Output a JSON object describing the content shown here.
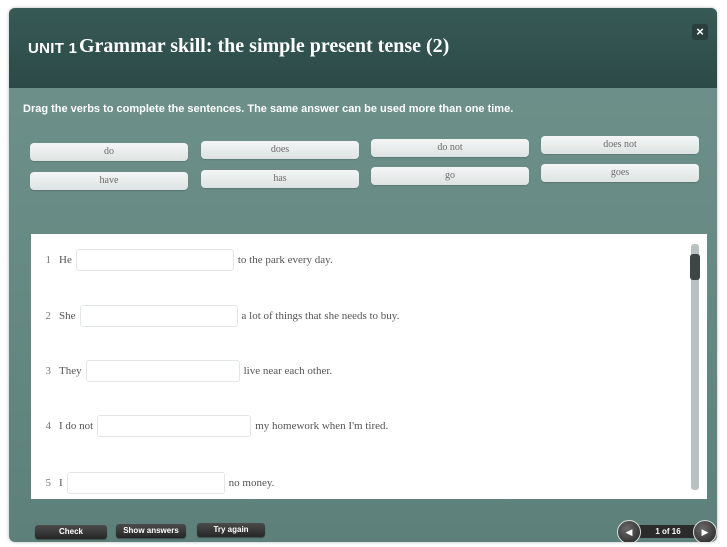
{
  "header": {
    "unit": "UNIT 1",
    "title": "Grammar skill: the simple present tense (2)",
    "close_symbol": "×"
  },
  "instruction": "Drag the verbs to complete the sentences. The same answer can be used more than one time.",
  "word_bank": [
    "do",
    "does",
    "do not",
    "does not",
    "have",
    "has",
    "go",
    "goes"
  ],
  "sentences": [
    {
      "number": "1",
      "before": "He",
      "after": "to the park every day."
    },
    {
      "number": "2",
      "before": "She",
      "after": "a lot of things that she needs to buy."
    },
    {
      "number": "3",
      "before": "They",
      "after": "live near each other."
    },
    {
      "number": "4",
      "before": "I do not",
      "after": "my homework when I'm tired."
    },
    {
      "number": "5",
      "before": "I",
      "after": "no money."
    }
  ],
  "footer": {
    "check": "Check",
    "show_answers": "Show answers",
    "try_again": "Try again",
    "page_indicator": "1 of 16",
    "prev_icon": "chevron-left-icon",
    "next_icon": "chevron-right-icon"
  },
  "colors": {
    "header_bg": "#2f4f4b",
    "panel_bg": "#6a8e88",
    "button_bg": "#333333"
  }
}
